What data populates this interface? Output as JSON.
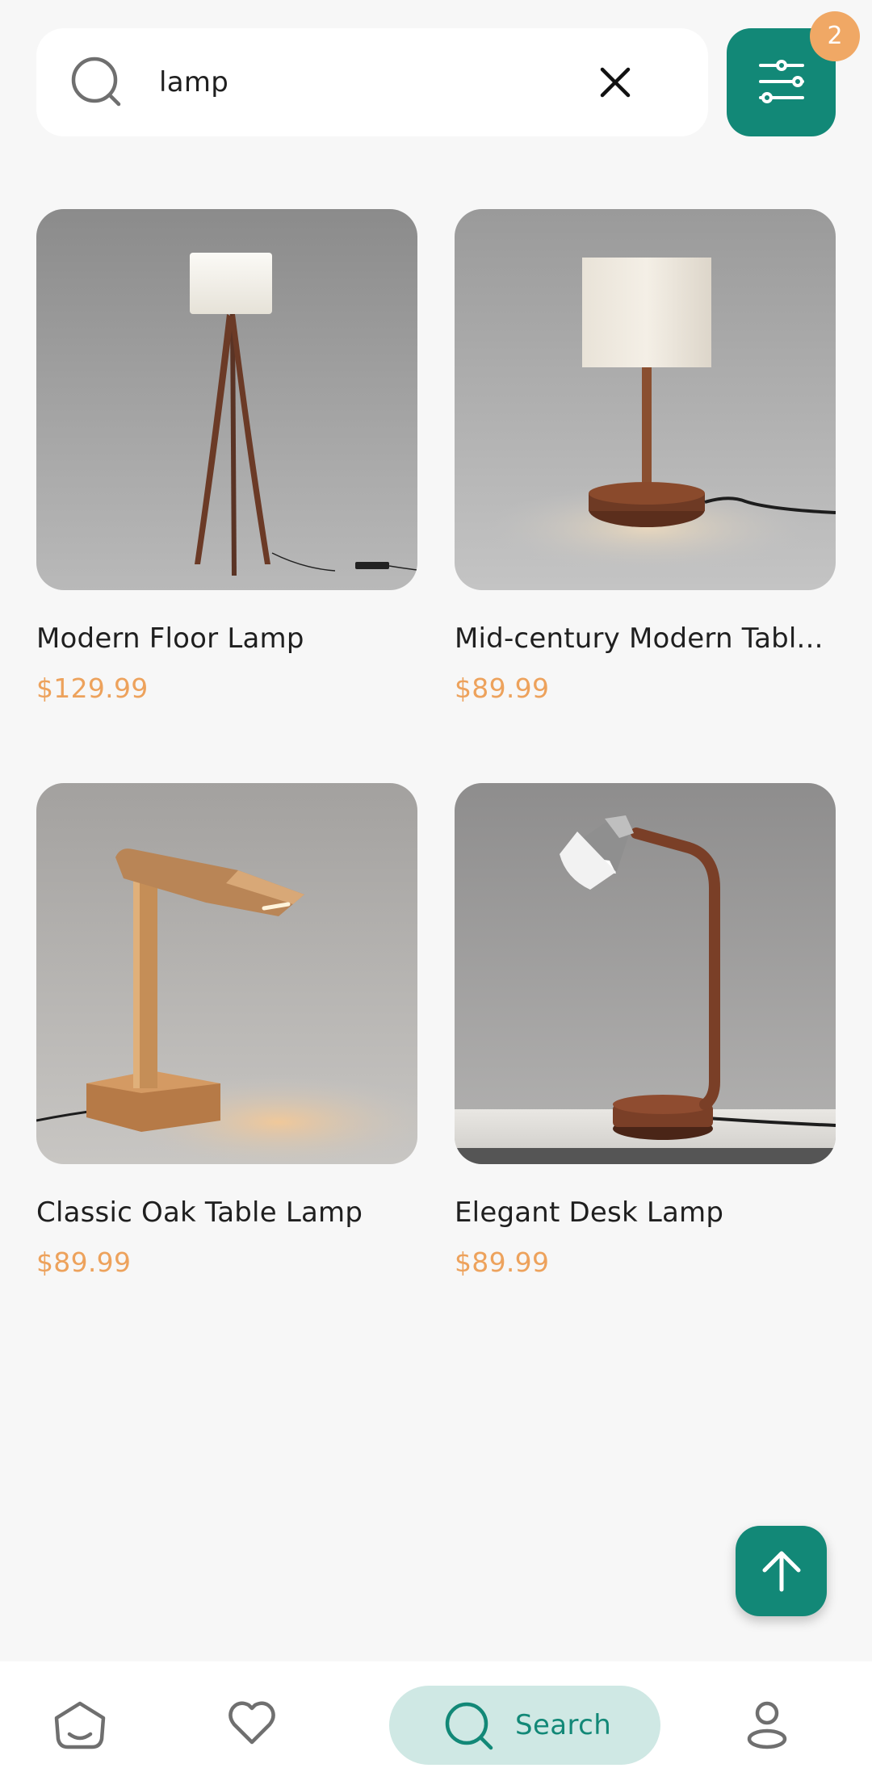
{
  "search": {
    "query": "lamp",
    "clear_icon": "close-icon",
    "search_icon": "search-icon"
  },
  "filter": {
    "icon": "sliders-icon",
    "badge_count": "2"
  },
  "products": [
    {
      "title": "Modern Floor Lamp",
      "price": "$129.99"
    },
    {
      "title": "Mid-century Modern Tabl...",
      "price": "$89.99"
    },
    {
      "title": "Classic Oak Table Lamp",
      "price": "$89.99"
    },
    {
      "title": "Elegant Desk Lamp",
      "price": "$89.99"
    }
  ],
  "scroll_top": {
    "icon": "arrow-up-icon"
  },
  "nav": {
    "home_icon": "home-icon",
    "favorites_icon": "heart-icon",
    "search_label": "Search",
    "profile_icon": "user-icon"
  },
  "colors": {
    "accent": "#128877",
    "price": "#eda25c",
    "badge": "#f0a865",
    "search_pill": "#cfe8e4"
  }
}
